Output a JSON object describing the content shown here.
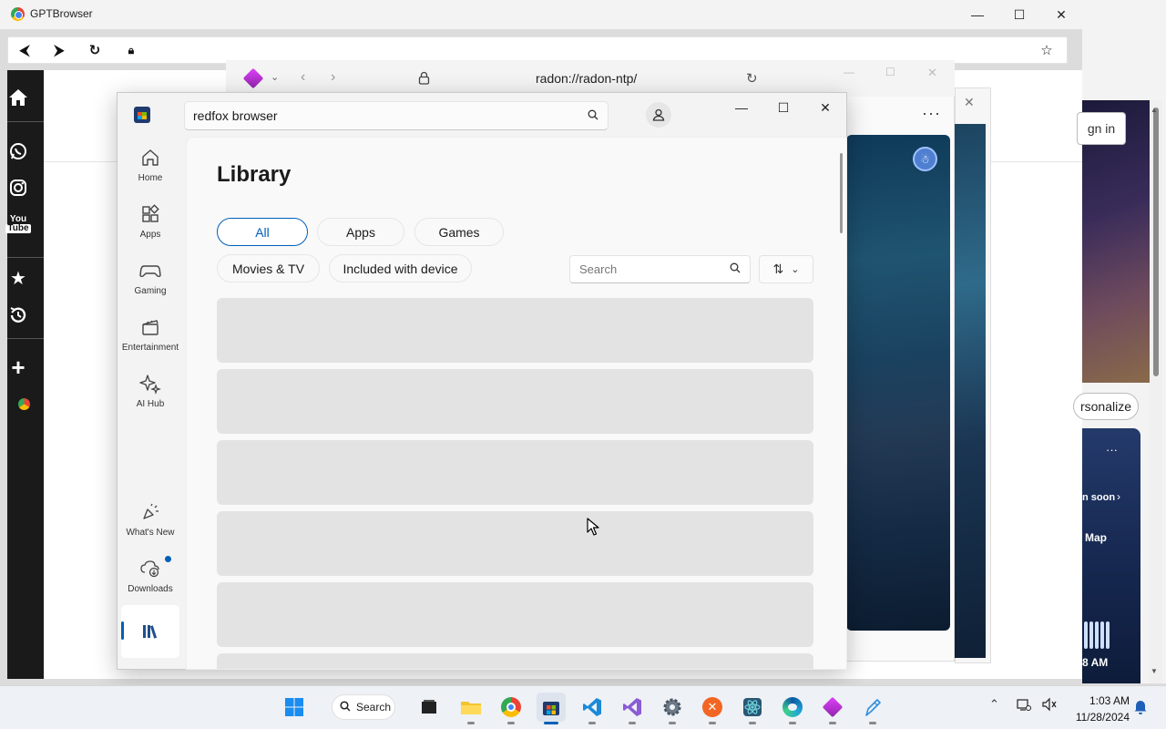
{
  "gpt_browser": {
    "title": "GPTBrowser",
    "window_controls": {
      "minimize": "—",
      "maximize": "☐",
      "close": "✕"
    },
    "address_value": ""
  },
  "right_panel": {
    "sign_in": "gn in",
    "personalize": "rsonalize",
    "coming_soon": "n soon",
    "map": "Map",
    "time_fragment": "8 AM"
  },
  "radon": {
    "url": "radon://radon-ntp/",
    "more": "···"
  },
  "store": {
    "search_value": "redfox browser",
    "nav": [
      {
        "label": "Home",
        "icon": "home-icon"
      },
      {
        "label": "Apps",
        "icon": "apps-icon"
      },
      {
        "label": "Gaming",
        "icon": "gaming-icon"
      },
      {
        "label": "Entertainment",
        "icon": "entertainment-icon"
      },
      {
        "label": "AI Hub",
        "icon": "ai-hub-icon"
      }
    ],
    "nav_bottom": [
      {
        "label": "What's New",
        "icon": "whats-new-icon"
      },
      {
        "label": "Downloads",
        "icon": "downloads-icon"
      }
    ],
    "library": {
      "title": "Library",
      "filters": [
        "All",
        "Apps",
        "Games",
        "Movies & TV",
        "Included with device"
      ],
      "active_filter": "All",
      "search_placeholder": "Search",
      "row_count": 6
    }
  },
  "taskbar": {
    "search_label": "Search",
    "time": "1:03 AM",
    "date": "11/28/2024",
    "apps": [
      "start",
      "search",
      "task-view",
      "file-explorer",
      "chrome",
      "microsoft-store",
      "vscode",
      "visual-studio",
      "settings",
      "xampp",
      "atom",
      "edge",
      "radon",
      "paint"
    ]
  },
  "colors": {
    "accent": "#005fb8",
    "gpt_sidebar": "#1a1a1a",
    "placeholder_row": "#e3e3e3"
  }
}
